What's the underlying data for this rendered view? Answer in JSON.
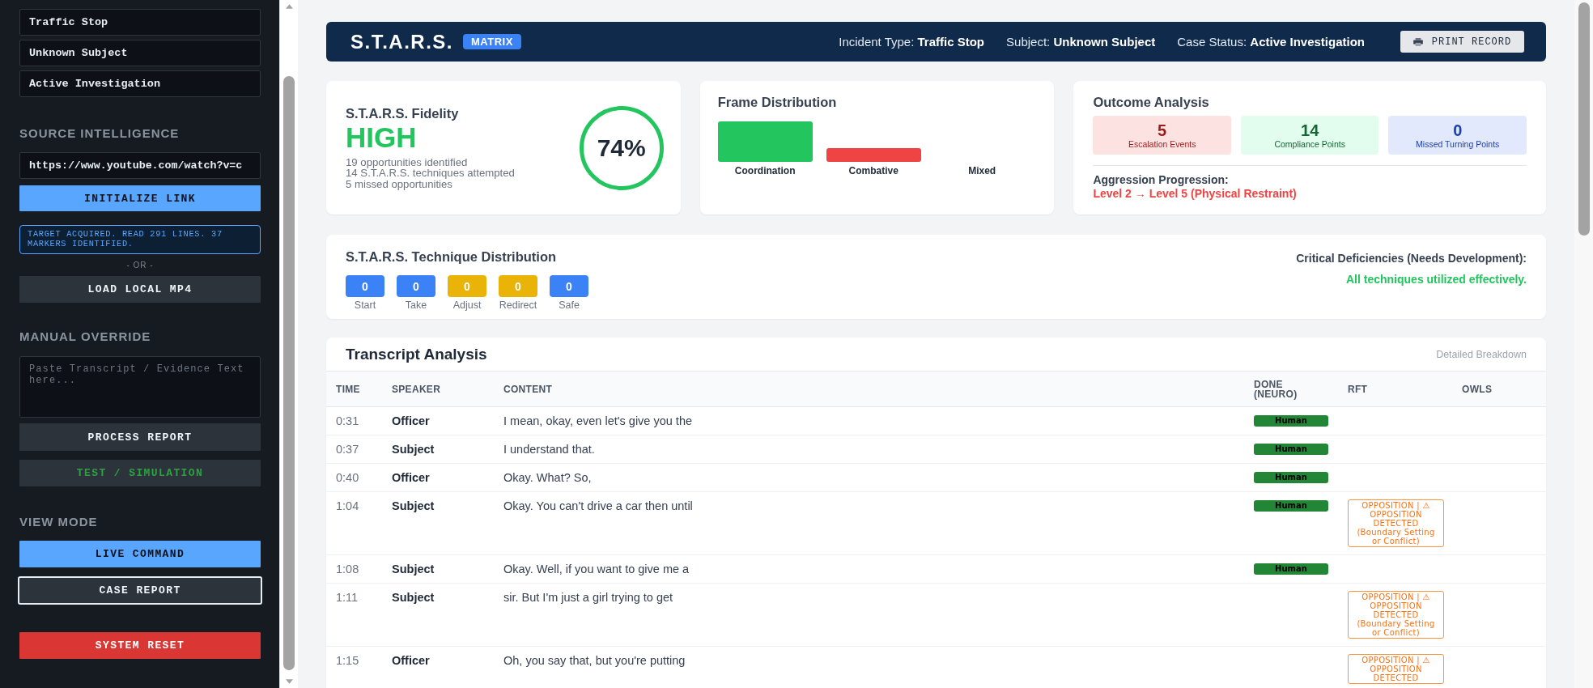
{
  "sidebar": {
    "case_fields": [
      "Traffic Stop",
      "Unknown Subject",
      "Active Investigation"
    ],
    "source": {
      "heading": "SOURCE INTELLIGENCE",
      "url": "https://www.youtube.com/watch?v=c",
      "button": "INITIALIZE LINK",
      "status": "TARGET ACQUIRED. READ 291 LINES. 37 MARKERS IDENTIFIED.",
      "divider": "- OR -",
      "load_button": "LOAD LOCAL MP4"
    },
    "manual": {
      "heading": "MANUAL OVERRIDE",
      "placeholder": "Paste Transcript / Evidence Text here...",
      "process_button": "PROCESS REPORT",
      "test_button": "TEST / SIMULATION"
    },
    "view_mode": {
      "heading": "VIEW MODE",
      "options": [
        {
          "label": "LIVE COMMAND",
          "selected": true,
          "focused": false
        },
        {
          "label": "CASE REPORT",
          "selected": false,
          "focused": true
        }
      ]
    },
    "reset_button": "SYSTEM RESET"
  },
  "header": {
    "title": "S.T.A.R.S.",
    "badge": "MATRIX",
    "meta": [
      "Incident Type: **Traffic Stop**",
      "Subject: **Unknown Subject**",
      "Case Status: **Active Investigation**"
    ],
    "print_button": "PRINT RECORD"
  },
  "fidelity": {
    "title": "S.T.A.R.S. Fidelity",
    "rating": "HIGH",
    "stats": [
      "19 opportunities identified",
      "14 S.T.A.R.S. techniques attempted",
      "5 missed opportunities"
    ],
    "score": "74%"
  },
  "frame_distribution": {
    "title": "Frame Distribution",
    "bars": [
      {
        "label": "Coordination",
        "color": "#22c55e"
      },
      {
        "label": "Combative",
        "color": "#ef4444"
      },
      {
        "label": "Mixed"
      }
    ]
  },
  "outcome": {
    "title": "Outcome Analysis",
    "tiles": [
      {
        "value": "5",
        "label": "Escalation Events",
        "color": "#991b1b"
      },
      {
        "value": "14",
        "label": "Compliance Points",
        "color": "#166534"
      },
      {
        "value": "0",
        "label": "Missed Turning Points",
        "color": "#1e40af"
      }
    ],
    "progression_label": "Aggression Progression:",
    "progression": "Level 2 → Level 5 (Physical Restraint)"
  },
  "techniques": {
    "title": "S.T.A.R.S. Technique Distribution",
    "items": [
      {
        "count": "0",
        "label": "Start",
        "color": "#3b82f6"
      },
      {
        "count": "0",
        "label": "Take",
        "color": "#3b82f6"
      },
      {
        "count": "0",
        "label": "Adjust",
        "color": "#eab308"
      },
      {
        "count": "0",
        "label": "Redirect",
        "color": "#eab308"
      },
      {
        "count": "0",
        "label": "Safe",
        "color": "#3b82f6"
      }
    ],
    "deficiency_title": "Critical Deficiencies (Needs Development):",
    "deficiency_text": "All techniques utilized effectively."
  },
  "transcript": {
    "title": "Transcript Analysis",
    "subtitle": "Detailed Breakdown",
    "columns": [
      "TIME",
      "SPEAKER",
      "CONTENT",
      "DONE (NEURO)",
      "RFT",
      "OWLS"
    ],
    "rows": [
      {
        "time": "0:31",
        "speaker": "Officer",
        "content": "I mean, okay, even let's give you the",
        "done": "Human"
      },
      {
        "time": "0:37",
        "speaker": "Subject",
        "content": "I understand that.",
        "done": "Human"
      },
      {
        "time": "0:40",
        "speaker": "Officer",
        "content": "Okay. What? So,",
        "done": "Human"
      },
      {
        "time": "1:04",
        "speaker": "Subject",
        "content": "Okay. You can't drive a car then until",
        "done": "Human",
        "rft": "OPPOSITION | ⚠ OPPOSITION DETECTED (Boundary Setting or Conflict)"
      },
      {
        "time": "1:08",
        "speaker": "Subject",
        "content": "Okay. Well, if you want to give me a",
        "done": "Human"
      },
      {
        "time": "1:11",
        "speaker": "Subject",
        "content": "sir. But I'm just a girl trying to get",
        "rft": "OPPOSITION | ⚠ OPPOSITION DETECTED (Boundary Setting or Conflict)"
      },
      {
        "time": "1:15",
        "speaker": "Officer",
        "content": "Oh, you say that, but you're putting",
        "rft": "OPPOSITION | ⚠ OPPOSITION DETECTED"
      }
    ]
  }
}
